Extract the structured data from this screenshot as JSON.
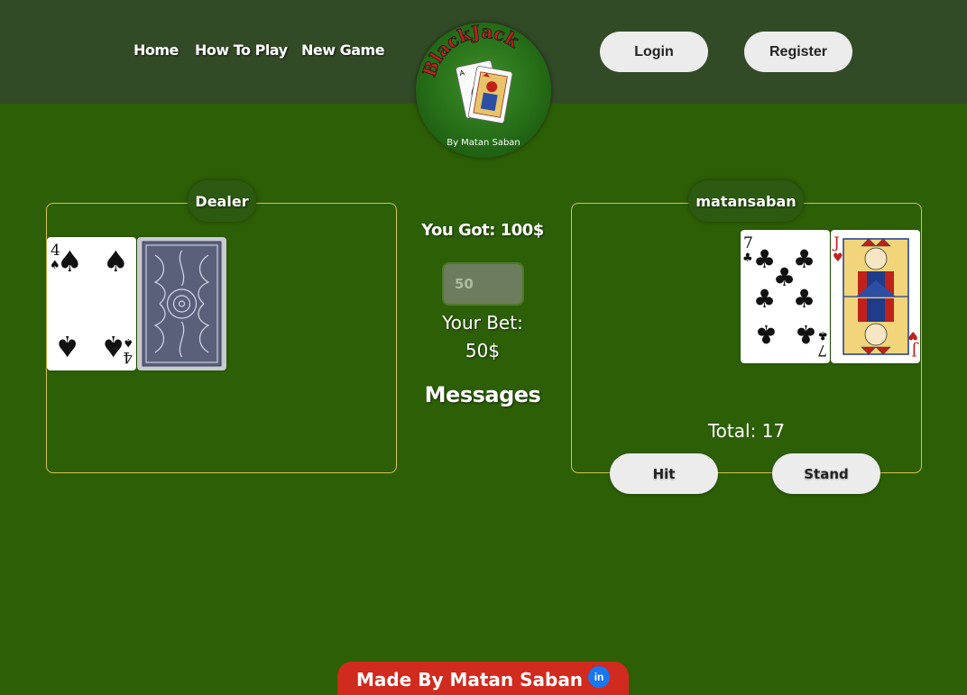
{
  "nav": {
    "home": "Home",
    "how_to_play": "How To Play",
    "new_game": "New Game",
    "login": "Login",
    "register": "Register"
  },
  "logo": {
    "title": "BlackJack",
    "subtitle": "By Matan Saban"
  },
  "dealer": {
    "label": "Dealer",
    "cards": [
      {
        "rank": "4",
        "suit": "spades",
        "face": "up"
      },
      {
        "rank": "",
        "suit": "",
        "face": "down"
      }
    ]
  },
  "center": {
    "balance": "You Got: 100$",
    "bet_input_placeholder": "50",
    "bet_label": "Your Bet:",
    "bet_value": "50$",
    "messages_title": "Messages"
  },
  "player": {
    "label": "matansaban",
    "cards": [
      {
        "rank": "7",
        "suit": "clubs",
        "face": "up"
      },
      {
        "rank": "J",
        "suit": "hearts",
        "face": "up"
      }
    ],
    "total": "Total: 17",
    "hit": "Hit",
    "stand": "Stand"
  },
  "footer": {
    "text": "Made By Matan Saban",
    "icon": "linkedin-icon"
  },
  "colors": {
    "felt": "#2d5f06",
    "topbar": "#334a27",
    "panel_border": "#d8c24a",
    "footer": "#d12a1e",
    "button": "#ececec"
  }
}
